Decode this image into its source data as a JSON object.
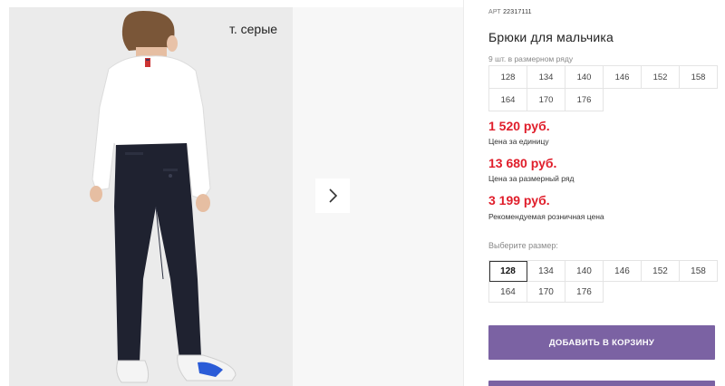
{
  "gallery": {
    "caption": "т. серые",
    "next_icon": "chevron-right-icon"
  },
  "product": {
    "article_label": "АРТ",
    "article_value": "22317111",
    "title": "Брюки для мальчика",
    "sizes_note": "9 шт. в размерном ряду",
    "size_range": [
      "128",
      "134",
      "140",
      "146",
      "152",
      "158",
      "164",
      "170",
      "176"
    ]
  },
  "prices": {
    "unit_price": "1 520 руб.",
    "unit_label": "Цена за единицу",
    "set_price": "13 680 руб.",
    "set_label": "Цена за размерный ряд",
    "retail_price": "3 199 руб.",
    "retail_label": "Рекомендуемая розничная цена"
  },
  "size_select": {
    "label": "Выберите размер:",
    "options": [
      "128",
      "134",
      "140",
      "146",
      "152",
      "158",
      "164",
      "170",
      "176"
    ],
    "selected": "128"
  },
  "cart": {
    "add_label": "ДОБАВИТЬ В КОРЗИНУ"
  },
  "colors": {
    "price": "#e01e2b",
    "accent": "#7b62a3"
  }
}
